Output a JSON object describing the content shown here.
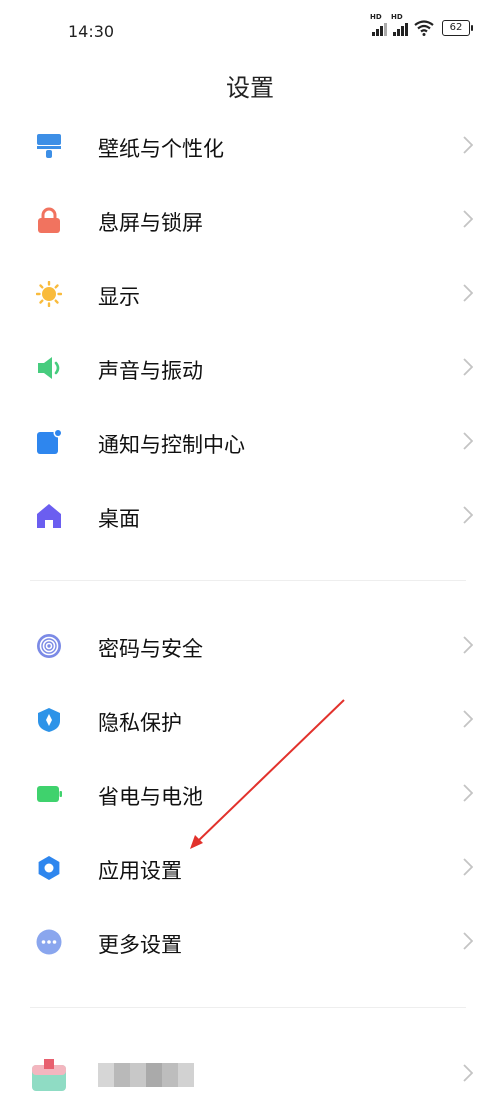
{
  "status_bar": {
    "time": "14:30",
    "battery": "62",
    "signal_badge": "HD"
  },
  "title": "设置",
  "groups": [
    {
      "items": [
        {
          "label": "壁纸与个性化",
          "icon": "paint-brush-icon"
        },
        {
          "label": "息屏与锁屏",
          "icon": "lock-icon"
        },
        {
          "label": "显示",
          "icon": "sun-icon"
        },
        {
          "label": "声音与振动",
          "icon": "speaker-icon"
        },
        {
          "label": "通知与控制中心",
          "icon": "notification-icon"
        },
        {
          "label": "桌面",
          "icon": "home-icon"
        }
      ]
    },
    {
      "items": [
        {
          "label": "密码与安全",
          "icon": "fingerprint-icon"
        },
        {
          "label": "隐私保护",
          "icon": "shield-icon"
        },
        {
          "label": "省电与电池",
          "icon": "battery-icon"
        },
        {
          "label": "应用设置",
          "icon": "gear-icon"
        },
        {
          "label": "更多设置",
          "icon": "more-icon"
        }
      ]
    }
  ],
  "colors": {
    "brush": "#3d8fe6",
    "lock": "#f1735f",
    "sun": "#f9bb3c",
    "speaker": "#47cc7e",
    "notification": "#2e86ee",
    "home": "#6b5ef0",
    "fingerprint": "#7b8ae6",
    "shield": "#2d93e8",
    "battery": "#3fd26d",
    "gear": "#2e86ee",
    "more": "#8aa6ee",
    "arrow": "#e2322c"
  }
}
